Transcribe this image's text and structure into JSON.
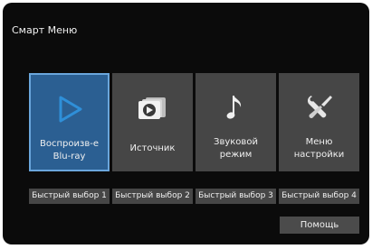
{
  "screen": {
    "title": "Смарт Меню"
  },
  "tiles": [
    {
      "label_line1": "Воспроизв-е",
      "label_line2": "Blu-ray",
      "icon": "play-icon",
      "selected": true
    },
    {
      "label_line1": "Источник",
      "label_line2": "",
      "icon": "input-source-icon",
      "selected": false
    },
    {
      "label_line1": "Звуковой",
      "label_line2": "режим",
      "icon": "music-note-icon",
      "selected": false
    },
    {
      "label_line1": "Меню",
      "label_line2": "настройки",
      "icon": "tools-icon",
      "selected": false
    }
  ],
  "quick_select": [
    {
      "label": "Быстрый выбор 1"
    },
    {
      "label": "Быстрый выбор 2"
    },
    {
      "label": "Быстрый выбор 3"
    },
    {
      "label": "Быстрый выбор 4"
    }
  ],
  "help": {
    "label": "Помощь"
  },
  "colors": {
    "background": "#0b0b0b",
    "tile": "#464646",
    "selected_tile": "#2b5f92",
    "selected_border": "#6aa6dc",
    "play_icon": "#2f8fd8"
  }
}
